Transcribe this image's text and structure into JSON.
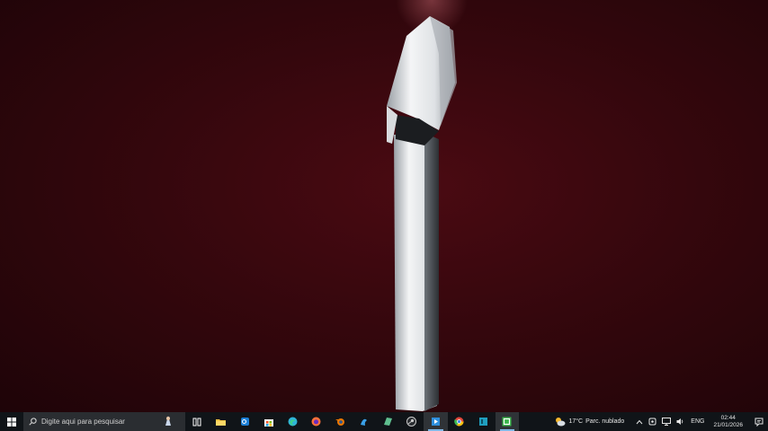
{
  "taskbar": {
    "search_placeholder": "Digite aqui para pesquisar",
    "apps": [
      {
        "name": "task-view",
        "color": "#ffffff"
      },
      {
        "name": "file-explorer",
        "color": "#f3c342"
      },
      {
        "name": "outlook",
        "color": "#1c7fd6"
      },
      {
        "name": "microsoft-store",
        "color": "#ffffff"
      },
      {
        "name": "edge",
        "color": "#2fb4d8"
      },
      {
        "name": "firefox",
        "color": "#ff7139"
      },
      {
        "name": "blender",
        "color": "#ea7600"
      },
      {
        "name": "app-blue",
        "color": "#3aa0e8"
      },
      {
        "name": "app-green",
        "color": "#5fbf8f"
      },
      {
        "name": "steam-like",
        "color": "#c9c9c9"
      },
      {
        "name": "media-player",
        "color": "#2f8fdd"
      },
      {
        "name": "chrome",
        "color": "#e0463a"
      },
      {
        "name": "app-teal",
        "color": "#1f9fbf"
      },
      {
        "name": "camtasia",
        "color": "#39b54a"
      }
    ],
    "weather": {
      "temperature": "17°C",
      "condition": "Parc. nublado"
    },
    "language": "ENG",
    "time": "02:44",
    "date": "21/01/2026"
  }
}
